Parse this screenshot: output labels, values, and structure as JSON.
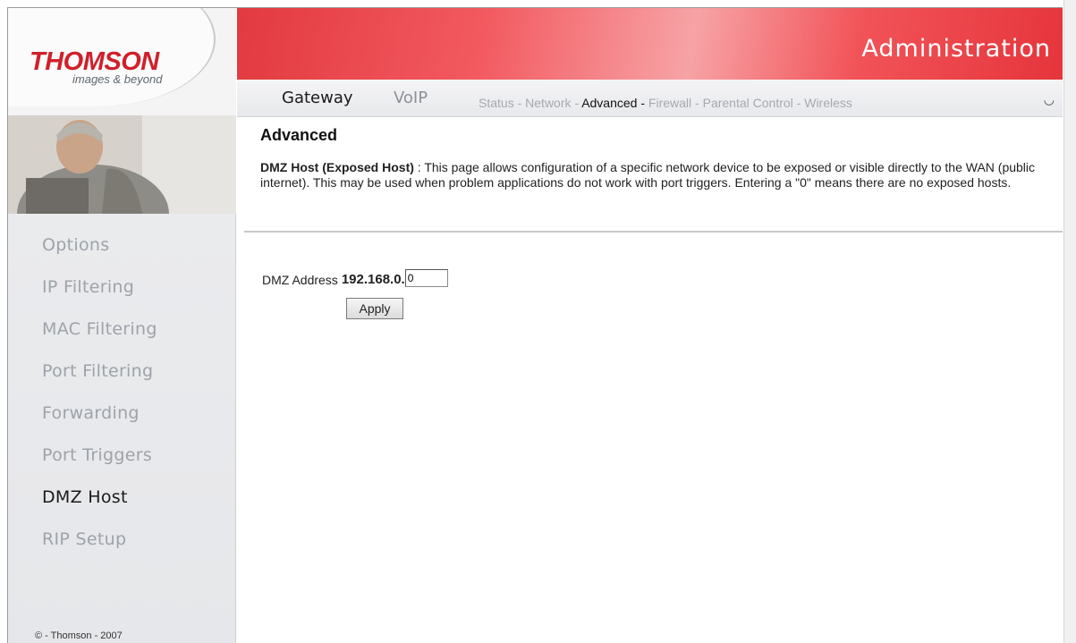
{
  "brand": {
    "logo": "THOMSON",
    "tagline": "images & beyond"
  },
  "header": {
    "title": "Administration"
  },
  "tabs": {
    "gateway": "Gateway",
    "voip": "VoIP"
  },
  "subnav": {
    "items": [
      "Status",
      "Network",
      "Advanced",
      "Firewall",
      "Parental Control",
      "Wireless"
    ],
    "separator": " - ",
    "selected": "Advanced"
  },
  "sidebar": {
    "items": [
      "Options",
      "IP Filtering",
      "MAC Filtering",
      "Port Filtering",
      "Forwarding",
      "Port Triggers",
      "DMZ Host",
      "RIP Setup"
    ],
    "active": "DMZ Host",
    "copyright": "© - Thomson - 2007"
  },
  "main": {
    "heading": "Advanced",
    "desc_title": "DMZ Host (Exposed Host)",
    "desc_sep": " : ",
    "desc_text": " This page allows configuration of a specific network device to be exposed or visible directly to the WAN (public internet). This may be used when problem applications do not work with port triggers. Entering a \"0\" means there are no exposed hosts.",
    "dmz_label": "DMZ Address",
    "dmz_prefix": "192.168.0.",
    "dmz_value": "0",
    "apply_label": "Apply"
  },
  "colors": {
    "brand_red": "#d0202a",
    "header_red": "#e23a40",
    "nav_inactive": "#9ea3aa",
    "nav_active": "#1a1a1a"
  }
}
